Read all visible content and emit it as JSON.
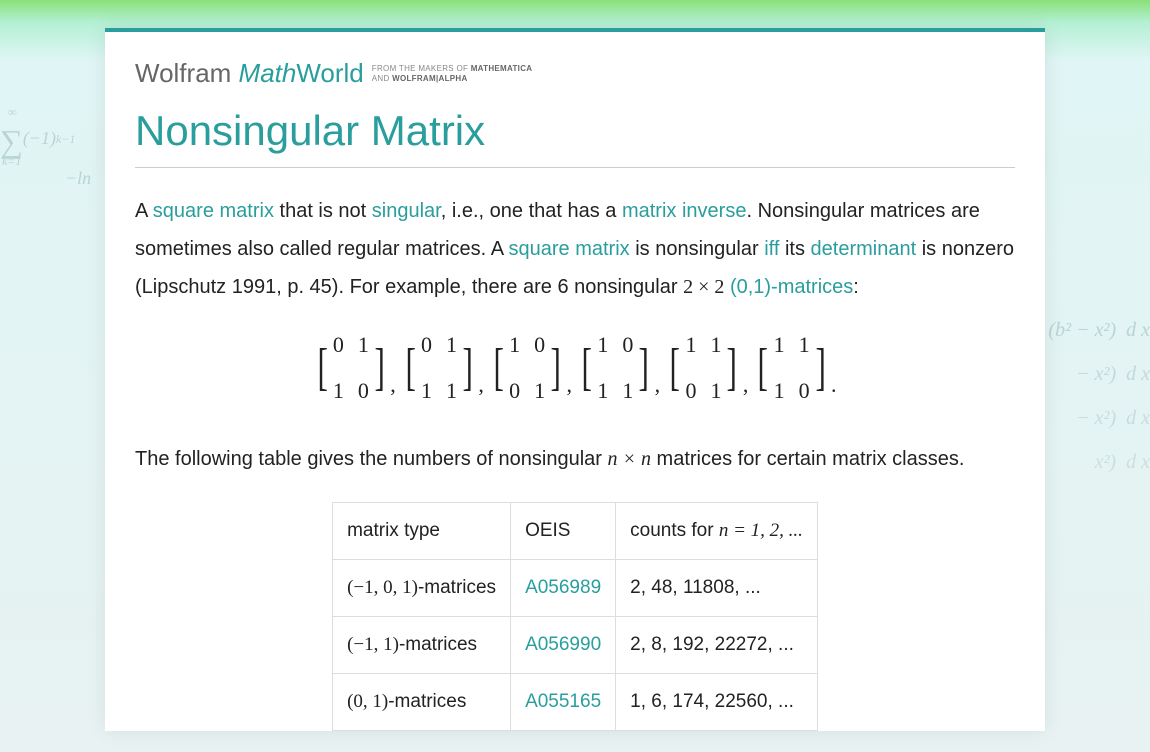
{
  "logo": {
    "prefix": "Wolfram ",
    "math": "Math",
    "world": "World",
    "sub_line1_a": "FROM THE MAKERS OF ",
    "sub_line1_b": "MATHEMATICA",
    "sub_line2_a": "AND ",
    "sub_line2_b": "WOLFRAM|ALPHA"
  },
  "title": "Nonsingular Matrix",
  "para1": {
    "t1": "A ",
    "link1": "square matrix",
    "t2": " that is not ",
    "link2": "singular",
    "t3": ", i.e., one that has a ",
    "link3": "matrix inverse",
    "t4": ". Nonsingular matrices are sometimes also called regular matrices. A ",
    "link4": "square matrix",
    "t5": " is nonsingular ",
    "link5": "iff",
    "t6": " its ",
    "link6": "determinant",
    "t7": " is nonzero (Lipschutz 1991, p. 45). For example, there are 6 nonsingular ",
    "math1": "2 × 2",
    "space1": " ",
    "link7": "(0,1)-matrices",
    "t8": ":"
  },
  "matrices": [
    [
      "0",
      "1",
      "1",
      "0"
    ],
    [
      "0",
      "1",
      "1",
      "1"
    ],
    [
      "1",
      "0",
      "0",
      "1"
    ],
    [
      "1",
      "0",
      "1",
      "1"
    ],
    [
      "1",
      "1",
      "0",
      "1"
    ],
    [
      "1",
      "1",
      "1",
      "0"
    ]
  ],
  "matrix_period": ".",
  "para2": {
    "t1": "The following table gives the numbers of nonsingular ",
    "math1": "n × n",
    "t2": " matrices for certain matrix classes."
  },
  "table": {
    "headers": [
      "matrix type",
      "OEIS",
      "counts for "
    ],
    "header_math": "n = 1, 2, ...",
    "rows": [
      {
        "type_math": "(−1, 0, 1)",
        "type_suffix": "-matrices",
        "oeis": "A056989",
        "counts": "2, 48, 11808, ..."
      },
      {
        "type_math": "(−1, 1)",
        "type_suffix": "-matrices",
        "oeis": "A056990",
        "counts": "2, 8, 192, 22272, ..."
      },
      {
        "type_math": "(0, 1)",
        "type_suffix": "-matrices",
        "oeis": "A055165",
        "counts": "1, 6, 174, 22560, ..."
      }
    ]
  },
  "bg": {
    "left1": "∑(−1)^(k−1)",
    "left2": "−ln",
    "right": "(b² − x²) dx\n−x²) dx\n−x²) dx\nx²) dx"
  }
}
